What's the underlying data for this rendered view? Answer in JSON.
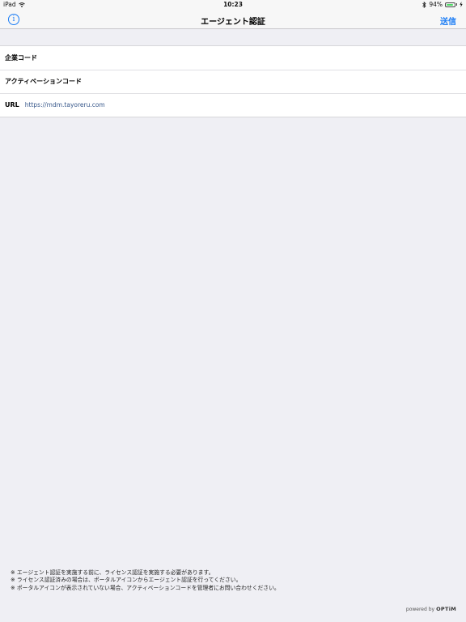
{
  "status_bar": {
    "device": "iPad",
    "time": "10:23",
    "battery_text": "94%",
    "battery_level": 0.94,
    "wifi_icon": "wifi-icon",
    "bluetooth_icon": "bluetooth-icon",
    "charging_icon": "charging-icon"
  },
  "nav": {
    "info_icon": "info-icon",
    "info_glyph": "i",
    "title": "エージェント認証",
    "send_label": "送信"
  },
  "form": {
    "company_code_label": "企業コード",
    "activation_code_label": "アクティベーションコード",
    "url_label": "URL",
    "url_value": "https://mdm.tayoreru.com"
  },
  "notes": [
    "※ エージェント認証を実施する前に、ライセンス認証を実施する必要があります。",
    "※ ライセンス認証済みの場合は、ポータルアイコンからエージェント認証を行ってください。",
    "※ ポータルアイコンが表示されていない場合、アクティベーションコードを管理者にお問い合わせください。"
  ],
  "footer": {
    "powered_by": "powered by",
    "brand": "OPTiM"
  },
  "colors": {
    "accent": "#1a7cf5",
    "background": "#efeff4",
    "battery": "#4cd964"
  }
}
